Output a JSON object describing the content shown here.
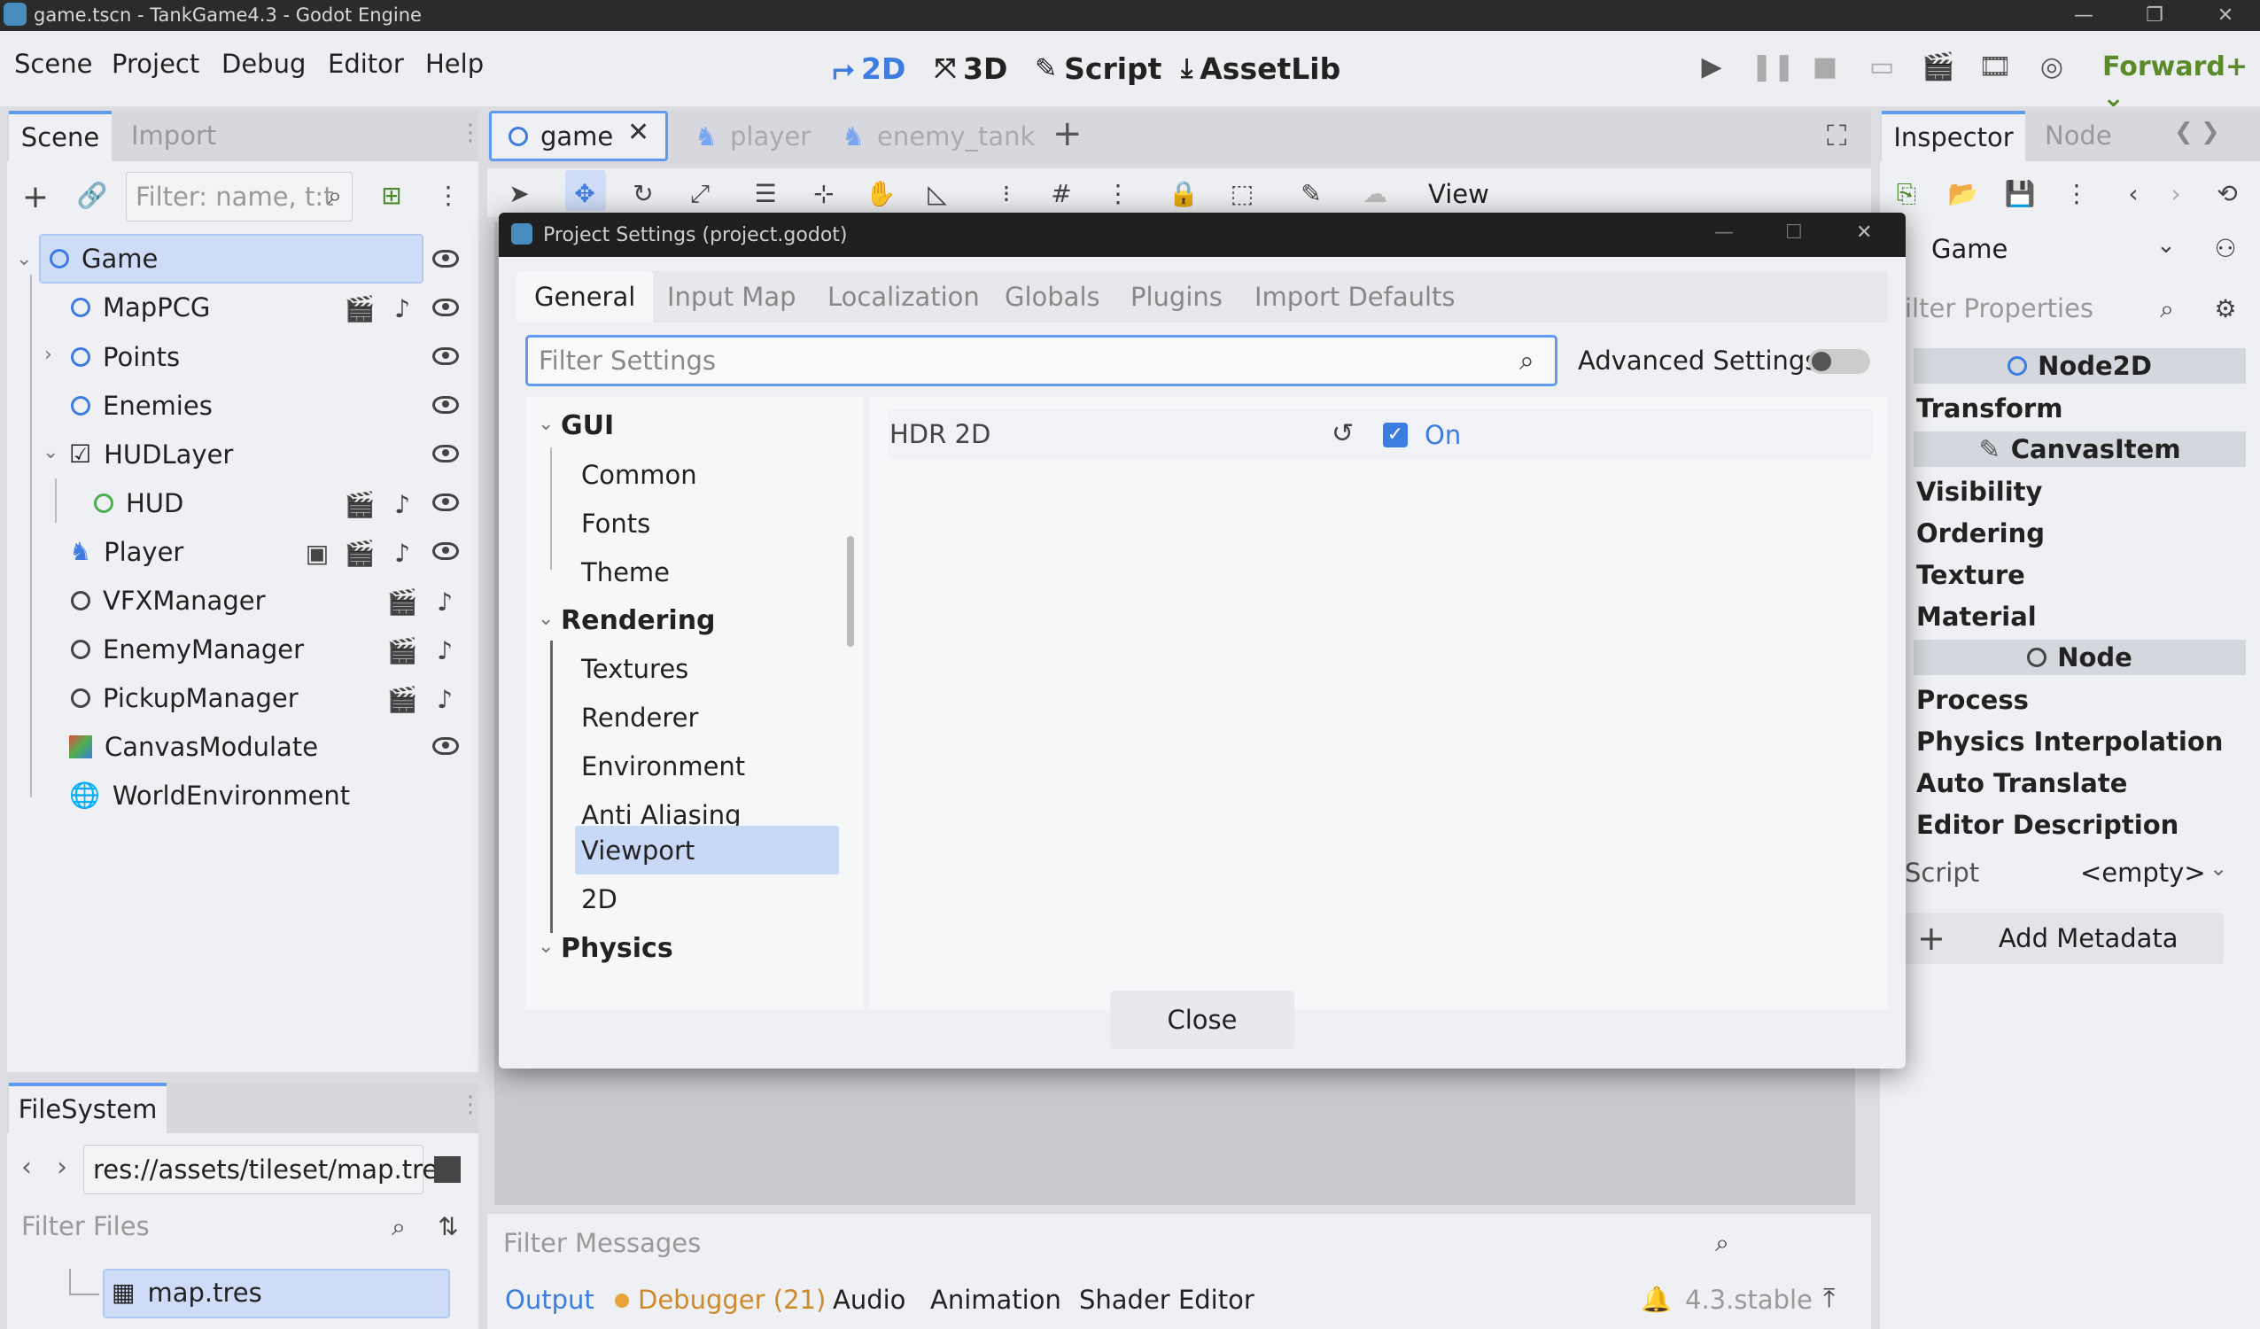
{
  "window": {
    "title": "game.tscn - TankGame4.3 - Godot Engine"
  },
  "menubar": {
    "menus": [
      "Scene",
      "Project",
      "Debug",
      "Editor",
      "Help"
    ],
    "workspaces": [
      "2D",
      "3D",
      "Script",
      "AssetLib"
    ],
    "renderer": "Forward+"
  },
  "scene_panel": {
    "tabs": [
      "Scene",
      "Import"
    ],
    "filter_placeholder": "Filter: name, t:t",
    "nodes": [
      "Game",
      "MapPCG",
      "Points",
      "Enemies",
      "HUDLayer",
      "HUD",
      "Player",
      "VFXManager",
      "EnemyManager",
      "PickupManager",
      "CanvasModulate",
      "WorldEnvironment"
    ]
  },
  "filesystem": {
    "tab": "FileSystem",
    "path": "res://assets/tileset/map.tre",
    "filter_placeholder": "Filter Files",
    "file": "map.tres"
  },
  "editor_tabs": [
    "game",
    "player",
    "enemy_tank"
  ],
  "toolbar": {
    "view_label": "View"
  },
  "dialog": {
    "title": "Project Settings (project.godot)",
    "tabs": [
      "General",
      "Input Map",
      "Localization",
      "Globals",
      "Plugins",
      "Import Defaults"
    ],
    "filter_placeholder": "Filter Settings",
    "advanced_label": "Advanced Settings",
    "sections": {
      "gui": "GUI",
      "gui_items": [
        "Common",
        "Fonts",
        "Theme"
      ],
      "rendering": "Rendering",
      "rendering_items": [
        "Textures",
        "Renderer",
        "Environment",
        "Anti Aliasing",
        "Viewport",
        "2D"
      ],
      "physics": "Physics"
    },
    "setting": {
      "name": "HDR 2D",
      "value": "On"
    },
    "close_label": "Close"
  },
  "inspector": {
    "tabs": [
      "Inspector",
      "Node"
    ],
    "object": "Game",
    "filter_placeholder": "ilter Properties",
    "sections": {
      "node2d": "Node2D",
      "canvasitem": "CanvasItem",
      "node": "Node"
    },
    "node2d_items": [
      "Transform"
    ],
    "canvas_items": [
      "Visibility",
      "Ordering",
      "Texture",
      "Material"
    ],
    "node_items": [
      "Process",
      "Physics Interpolation",
      "Auto Translate",
      "Editor Description"
    ],
    "script_label": "Script",
    "script_value": "<empty>",
    "add_metadata": "Add Metadata"
  },
  "bottom": {
    "filter_placeholder": "Filter Messages",
    "tabs": [
      "Output",
      "Debugger (21)",
      "Audio",
      "Animation",
      "Shader Editor"
    ],
    "version": "4.3.stable"
  },
  "colors": {
    "accent": "#478cbf",
    "active_blue": "#3d7ce0",
    "warning": "#e8a33a"
  }
}
